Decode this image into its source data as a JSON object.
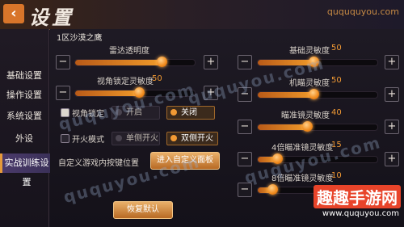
{
  "header": {
    "back_icon": "‹",
    "title": "设置",
    "watermark_top": "quququyou.com"
  },
  "sidebar": {
    "items": [
      {
        "label": "基础设置"
      },
      {
        "label": "操作设置"
      },
      {
        "label": "系统设置"
      },
      {
        "label": "外设"
      },
      {
        "label": "实战训练设置"
      }
    ]
  },
  "server": "1区沙漠之鹰",
  "sliders_left": [
    {
      "label": "雷达透明度",
      "value": "",
      "percent": 74
    },
    {
      "label": "视角锁定灵敏度",
      "value": "50",
      "percent": 50
    }
  ],
  "sliders_right": [
    {
      "label": "基础灵敏度",
      "value": "50",
      "percent": 50
    },
    {
      "label": "机瞄灵敏度",
      "value": "50",
      "percent": 50
    },
    {
      "label": "瞄准镜灵敏度",
      "value": "40",
      "percent": 40
    },
    {
      "label": "4倍瞄准镜灵敏度",
      "value": "15",
      "percent": 15
    },
    {
      "label": "8倍瞄准镜灵敏度",
      "value": "10",
      "percent": 10
    }
  ],
  "perspective_lock": {
    "label": "视角锁定",
    "options": [
      "开启",
      "关闭"
    ],
    "selected": "关闭"
  },
  "fire_mode": {
    "label": "开火模式",
    "options": [
      "单侧开火",
      "双侧开火"
    ],
    "selected": "双侧开火"
  },
  "custom": {
    "label": "自定义游戏内按键位置",
    "button": "进入自定义面板"
  },
  "reset_button": "恢复默认",
  "watermarks": [
    "ququyou.com",
    "ququyou.com",
    "ququyou.com",
    "ququyou.com"
  ],
  "brand": {
    "title": "趣趣手游网",
    "url": "www.ququyou.com"
  },
  "colors": {
    "accent": "#f29a34",
    "active_nav": "#4a3a6a"
  }
}
